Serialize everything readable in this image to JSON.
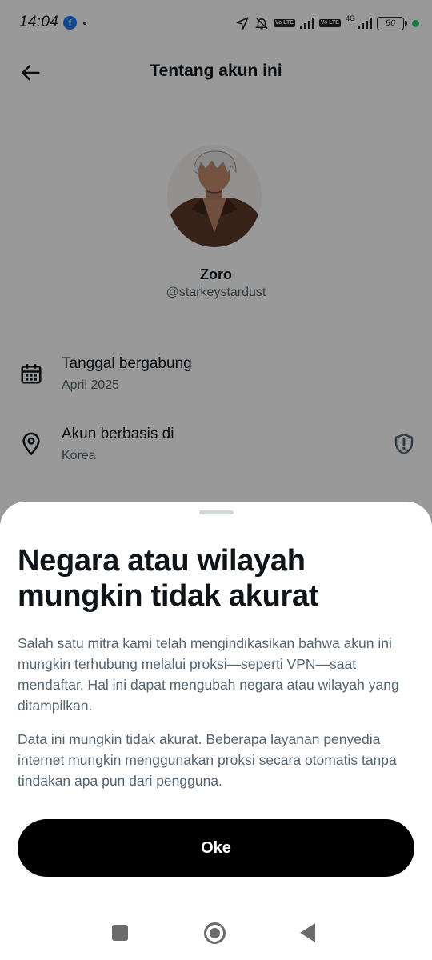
{
  "status_bar": {
    "time": "14:04",
    "network_type": "4G",
    "battery": "86",
    "volte_label": "Vo LTE"
  },
  "header": {
    "title": "Tentang akun ini"
  },
  "profile": {
    "name": "Zoro",
    "handle": "@starkeystardust"
  },
  "info_rows": [
    {
      "title": "Tanggal bergabung",
      "value": "April 2025",
      "icon": "calendar-icon"
    },
    {
      "title": "Akun berbasis di",
      "value": "Korea",
      "icon": "location-pin-icon",
      "extra_icon": "shield-alert-icon"
    }
  ],
  "sheet": {
    "title": "Negara atau wilayah mungkin tidak akurat",
    "paragraph_1": "Salah satu mitra kami telah mengindikasikan bahwa akun ini mungkin terhubung melalui proksi—seperti VPN—saat mendaftar. Hal ini dapat mengubah negara atau wilayah yang ditampilkan.",
    "paragraph_2": "Data ini mungkin tidak akurat. Beberapa layanan penyedia internet mungkin menggunakan proksi secara otomatis tanpa tindakan apa pun dari pengguna.",
    "ok_label": "Oke"
  },
  "colors": {
    "primary_text": "#0f1419",
    "secondary_text": "#536471",
    "button_bg": "#000000",
    "overlay": "rgba(0,0,0,0.40)"
  }
}
